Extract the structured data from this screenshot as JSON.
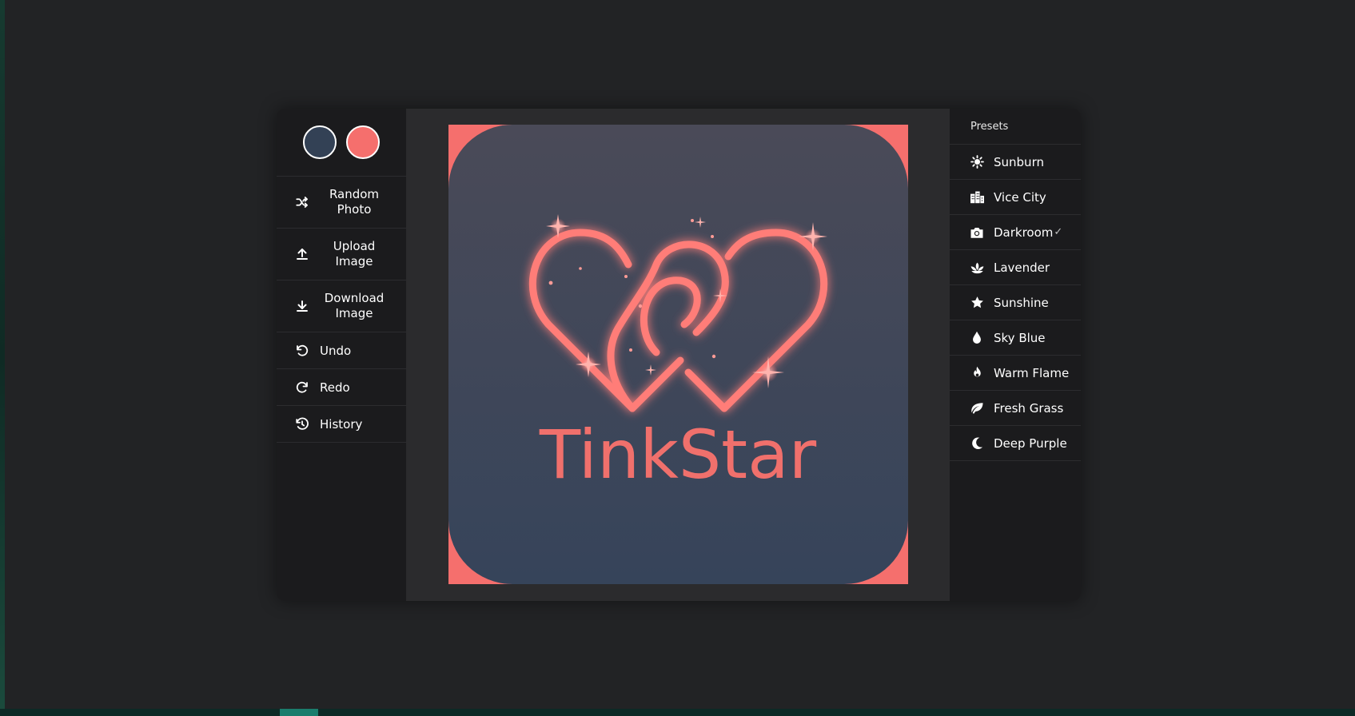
{
  "colors": {
    "primary": "#334155",
    "secondary": "#f56f6d"
  },
  "left_panel": {
    "swatches": [
      {
        "name": "dark-slate",
        "color": "#334155"
      },
      {
        "name": "coral",
        "color": "#f56f6d"
      }
    ],
    "tools": [
      {
        "label": "Random\nPhoto",
        "icon": "shuffle-icon"
      },
      {
        "label": "Upload\nImage",
        "icon": "upload-icon"
      },
      {
        "label": "Download\nImage",
        "icon": "download-icon"
      },
      {
        "label": "Undo",
        "icon": "undo-icon"
      },
      {
        "label": "Redo",
        "icon": "redo-icon"
      },
      {
        "label": "History",
        "icon": "history-icon"
      }
    ]
  },
  "artwork": {
    "logo_text": "TinkStar",
    "background": "#f56f6d",
    "card_top": "#4a4a58",
    "card_bottom": "#36445a"
  },
  "presets": {
    "title": "Presets",
    "selected": "Darkroom",
    "check_mark": "✓",
    "items": [
      {
        "label": "Sunburn",
        "icon": "sun-icon"
      },
      {
        "label": "Vice City",
        "icon": "city-icon"
      },
      {
        "label": "Darkroom",
        "icon": "camera-icon"
      },
      {
        "label": "Lavender",
        "icon": "lotus-icon"
      },
      {
        "label": "Sunshine",
        "icon": "star-icon"
      },
      {
        "label": "Sky Blue",
        "icon": "droplet-icon"
      },
      {
        "label": "Warm Flame",
        "icon": "fire-icon"
      },
      {
        "label": "Fresh Grass",
        "icon": "leaf-icon"
      },
      {
        "label": "Deep Purple",
        "icon": "moon-icon"
      }
    ]
  }
}
